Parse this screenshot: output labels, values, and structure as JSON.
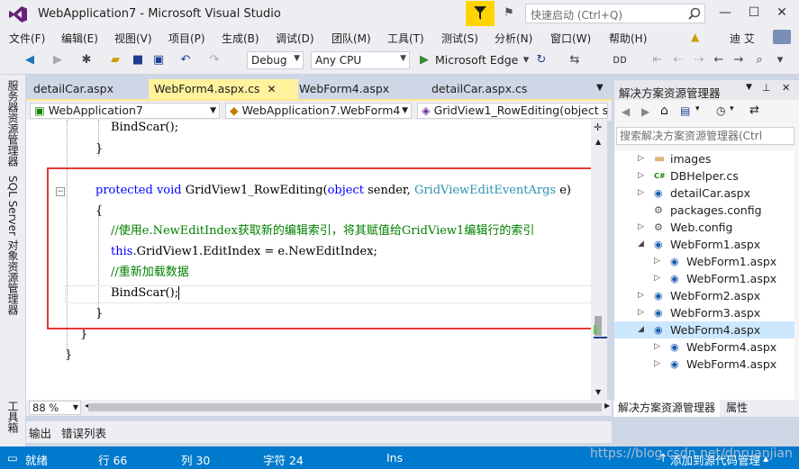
{
  "window": {
    "title": "WebApplication7 - Microsoft Visual Studio",
    "quick_launch_placeholder": "快速启动 (Ctrl+Q)",
    "user": "迪 艾",
    "controls": [
      "minimize",
      "maximize",
      "close"
    ]
  },
  "menu": [
    "文件(F)",
    "编辑(E)",
    "视图(V)",
    "项目(P)",
    "生成(B)",
    "调试(D)",
    "团队(M)",
    "工具(T)",
    "测试(S)",
    "分析(N)",
    "窗口(W)",
    "帮助(H)"
  ],
  "toolbar": {
    "config": "Debug",
    "platform": "Any CPU",
    "run_target": "Microsoft Edge"
  },
  "left_strip": [
    "服务器资源管理器",
    "SQL Server 对象资源管理器",
    "工具箱"
  ],
  "doc_tabs": [
    {
      "label": "detailCar.aspx",
      "active": false
    },
    {
      "label": "WebForm4.aspx.cs",
      "active": true
    },
    {
      "label": "WebForm4.aspx",
      "active": false
    },
    {
      "label": "detailCar.aspx.cs",
      "active": false
    }
  ],
  "navbar": {
    "project": "WebApplication7",
    "class": "WebApplication7.WebForm4",
    "member": "GridView1_RowEditing(object s"
  },
  "code": {
    "line1": "BindScar();",
    "line2": "}",
    "sig_kw1": "protected",
    "sig_kw2": "void",
    "sig_name": "GridView1_RowEditing(",
    "sig_kw3": "object",
    "sig_mid": "sender,",
    "sig_type": "GridViewEditEventArgs",
    "sig_end": "e)",
    "open_brace": "{",
    "comment1": "//使用e.NewEditIndex获取新的编辑索引，将其赋值给GridView1编辑行的索引",
    "this_kw": "this",
    "assign": ".GridView1.EditIndex = e.NewEditIndex;",
    "comment2": "//重新加载数据",
    "bind": "BindScar();",
    "close_brace": "}",
    "close_brace2": "}",
    "close_brace3": "}"
  },
  "zoom": "88 %",
  "output_tabs": [
    "输出",
    "错误列表"
  ],
  "solution_explorer": {
    "title": "解决方案资源管理器",
    "search_placeholder": "搜索解决方案资源管理器(Ctrl",
    "items": [
      {
        "label": "images",
        "icon": "folder-icon",
        "indent": 1,
        "expander": "collapsed"
      },
      {
        "label": "DBHelper.cs",
        "icon": "csharp-file-icon",
        "indent": 1,
        "expander": "collapsed"
      },
      {
        "label": "detailCar.aspx",
        "icon": "web-file-icon",
        "indent": 1,
        "expander": "collapsed"
      },
      {
        "label": "packages.config",
        "icon": "config-file-icon",
        "indent": 1,
        "expander": "none"
      },
      {
        "label": "Web.config",
        "icon": "config-file-icon",
        "indent": 1,
        "expander": "collapsed"
      },
      {
        "label": "WebForm1.aspx",
        "icon": "web-file-icon",
        "indent": 1,
        "expander": "expanded"
      },
      {
        "label": "WebForm1.aspx",
        "icon": "web-file-icon",
        "indent": 2,
        "expander": "collapsed"
      },
      {
        "label": "WebForm1.aspx",
        "icon": "web-file-icon",
        "indent": 2,
        "expander": "collapsed"
      },
      {
        "label": "WebForm2.aspx",
        "icon": "web-file-icon",
        "indent": 1,
        "expander": "collapsed"
      },
      {
        "label": "WebForm3.aspx",
        "icon": "web-file-icon",
        "indent": 1,
        "expander": "collapsed"
      },
      {
        "label": "WebForm4.aspx",
        "icon": "web-file-icon",
        "indent": 1,
        "expander": "expanded",
        "selected": true
      },
      {
        "label": "WebForm4.aspx",
        "icon": "web-file-icon",
        "indent": 2,
        "expander": "collapsed"
      },
      {
        "label": "WebForm4.aspx",
        "icon": "web-file-icon",
        "indent": 2,
        "expander": "collapsed"
      }
    ],
    "bottom_tabs": [
      "解决方案资源管理器",
      "属性"
    ]
  },
  "status": {
    "ready": "就绪",
    "line": "行 66",
    "col": "列 30",
    "char": "字符 24",
    "mode": "Ins",
    "source_control": "添加到源代码管理"
  },
  "watermark": "https://blog.csdn.net/dnruanjian",
  "colors": {
    "accent": "#007acc",
    "highlight_box": "#e53935",
    "keyword": "#0000ff",
    "type": "#2b91af",
    "comment": "#008000"
  }
}
